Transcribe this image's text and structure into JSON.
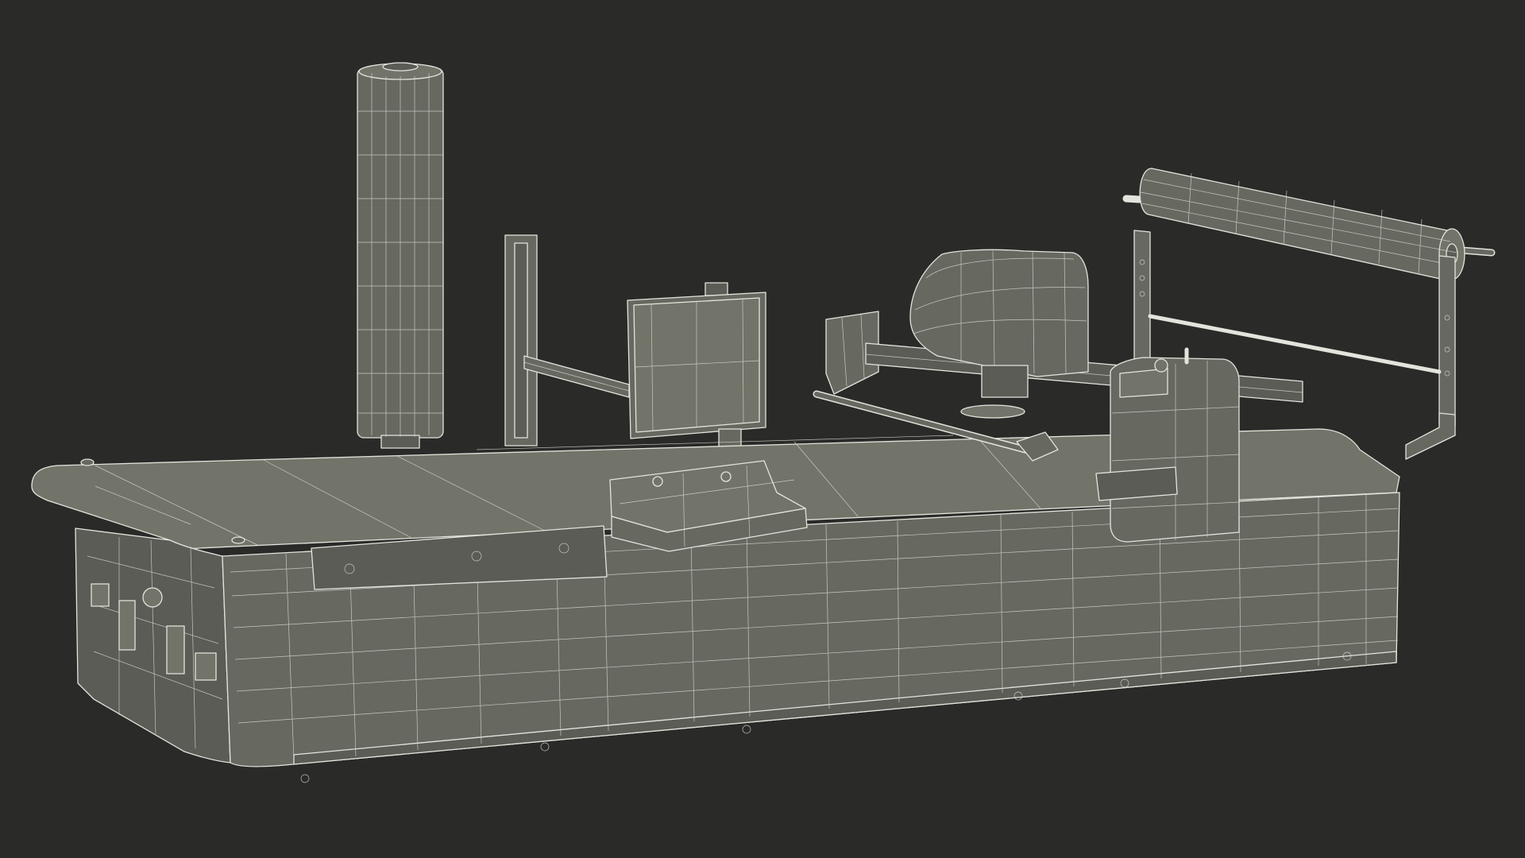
{
  "scene": {
    "background": "#2a2a29",
    "surface_color": "#676961",
    "wire_color": "#e4e4dd"
  }
}
